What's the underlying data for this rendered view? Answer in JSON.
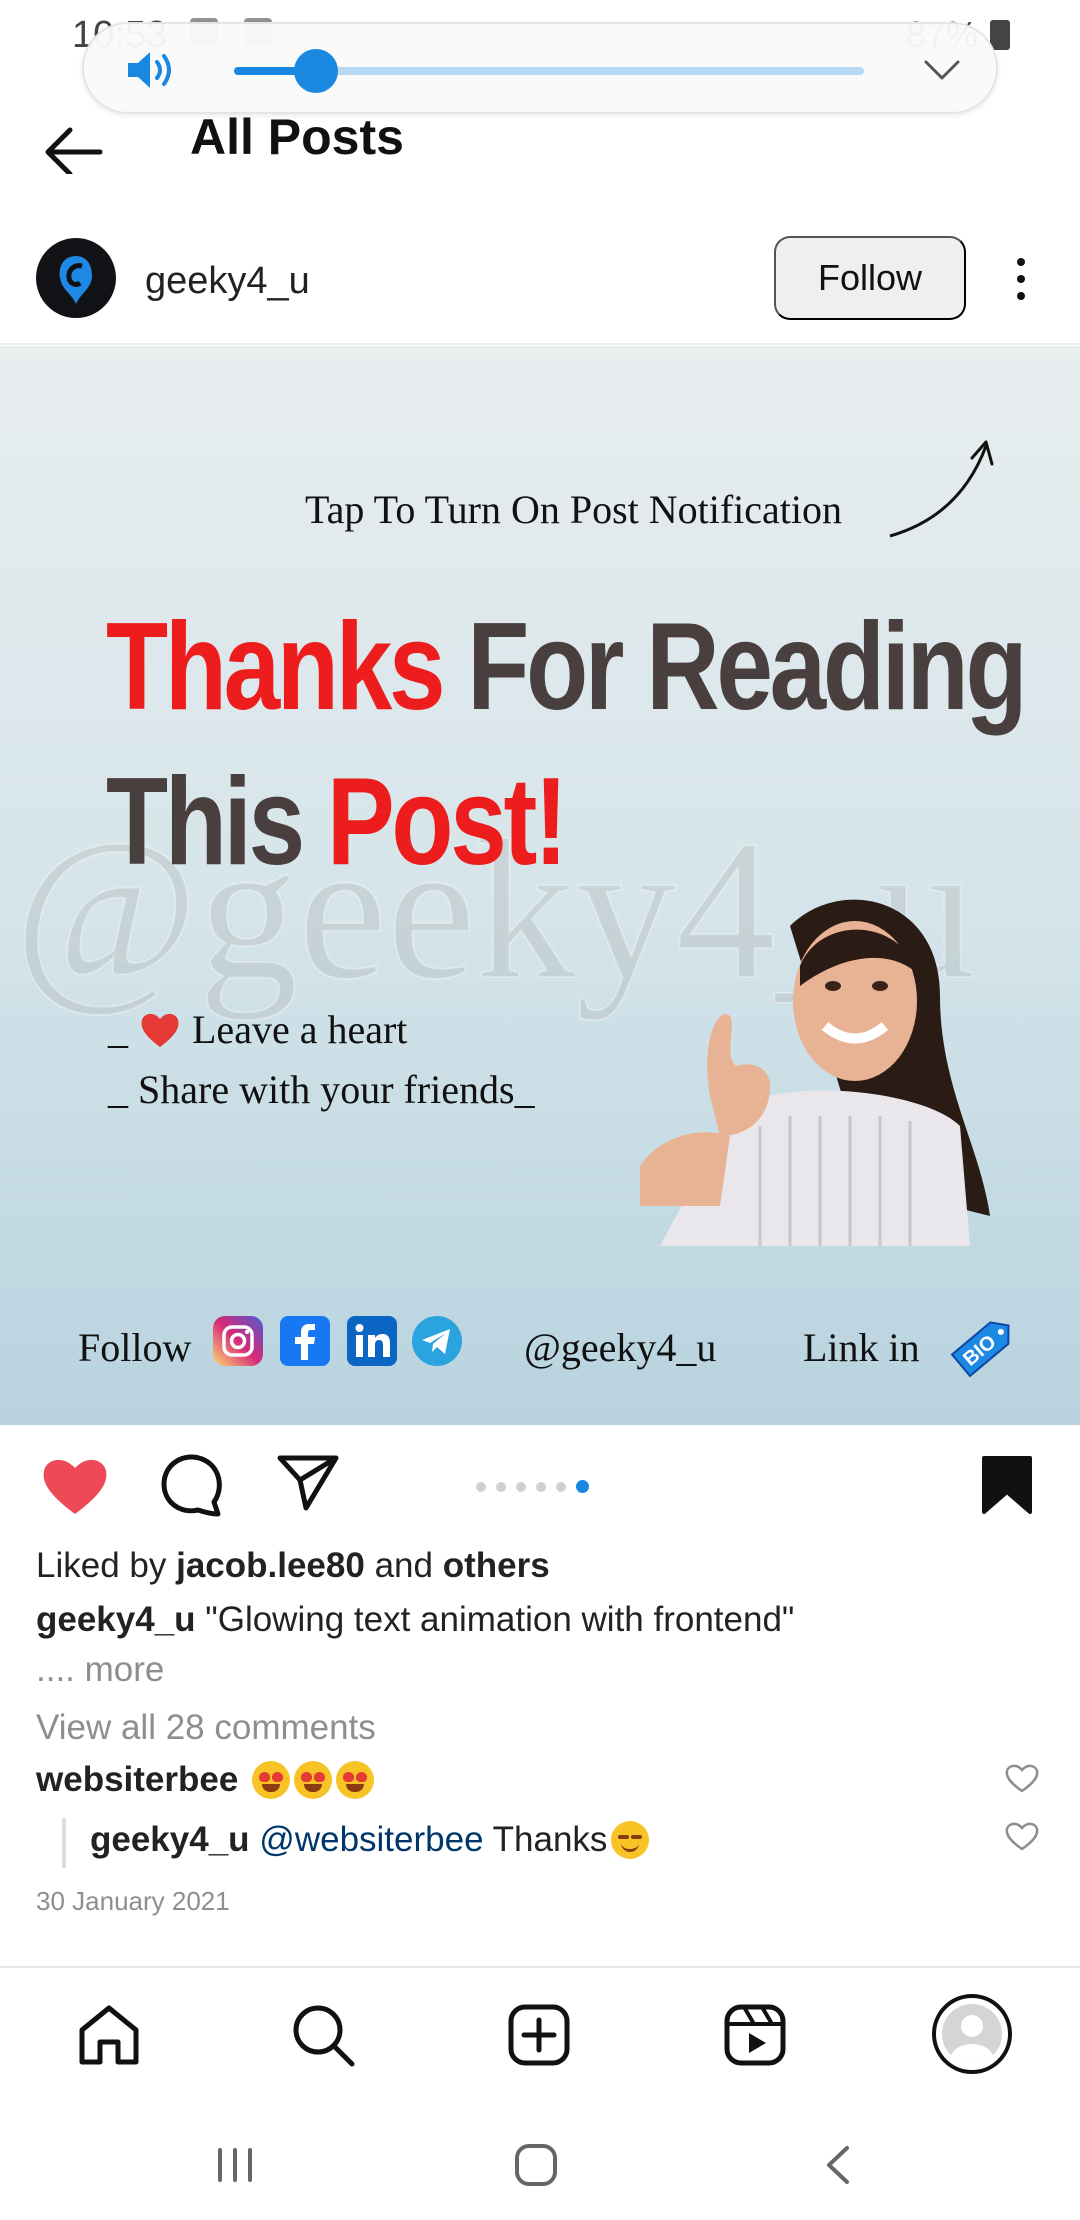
{
  "status_bar": {
    "time": "10:53",
    "battery": "87%"
  },
  "volume": {
    "level_percent": 13
  },
  "header": {
    "title": "All Posts"
  },
  "post": {
    "username": "geeky4_u",
    "follow_label": "Follow",
    "image": {
      "notification_text": "Tap To Turn On Post Notification",
      "headline_line1_red": "Thanks",
      "headline_line1_dark": "For Reading",
      "headline_line2_dark": "This",
      "headline_line2_red": "Post!",
      "watermark": "@geeky4_u",
      "bullet1_prefix": "_",
      "bullet1_text": "Leave a heart",
      "bullet2_text": "_ Share with your friends_",
      "follow_label": "Follow",
      "handle": "@geeky4_u",
      "link_in": "Link in",
      "bio_tag": "BIO"
    },
    "carousel": {
      "count": 6,
      "active_index": 5
    },
    "likes": {
      "prefix": "Liked by",
      "user": "jacob.lee80",
      "middle": "and",
      "others": "others"
    },
    "caption": {
      "user": "geeky4_u",
      "text": "\"Glowing text animation with frontend\"",
      "more": ".... more"
    },
    "view_comments": "View all 28 comments",
    "comments": [
      {
        "user": "websiterbee"
      }
    ],
    "reply": {
      "user": "geeky4_u",
      "mention": "@websiterbee",
      "text": "Thanks"
    },
    "date": "30 January 2021"
  },
  "colors": {
    "accent": "#1a88e0",
    "like_red": "#ed4956",
    "headline_red": "#ee1d1d",
    "headline_dark": "#4a3f3f"
  }
}
